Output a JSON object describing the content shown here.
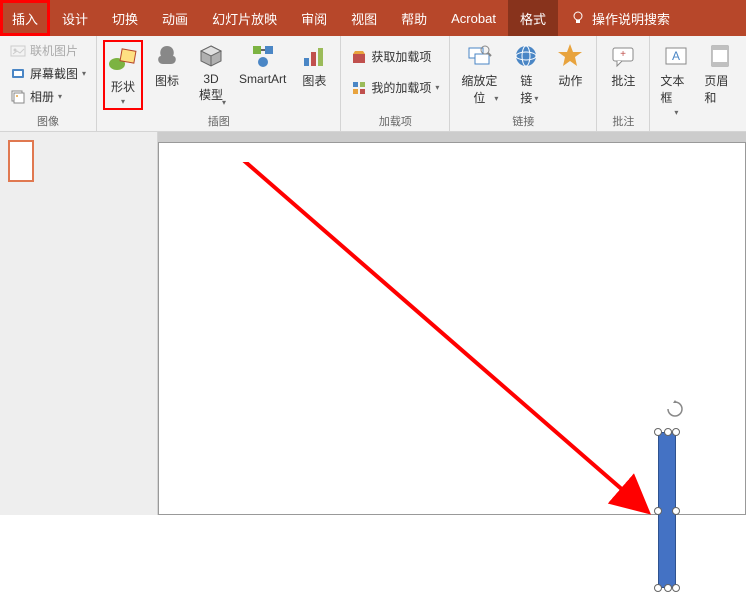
{
  "tabs": {
    "insert": "插入",
    "design": "设计",
    "transition": "切换",
    "animation": "动画",
    "slideshow": "幻灯片放映",
    "review": "审阅",
    "view": "视图",
    "help": "帮助",
    "acrobat": "Acrobat",
    "format": "格式",
    "search": "操作说明搜索"
  },
  "ribbon": {
    "images": {
      "online_pic": "联机图片",
      "screenshot": "屏幕截图",
      "album": "相册",
      "group": "图像"
    },
    "illustrations": {
      "shapes": "形状",
      "icons": "图标",
      "model3d_1": "3D",
      "model3d_2": "模型",
      "smartart": "SmartArt",
      "chart": "图表",
      "group": "插图"
    },
    "addins": {
      "get": "获取加载项",
      "my": "我的加载项",
      "group": "加载项"
    },
    "links": {
      "zoom_1": "缩放定",
      "zoom_2": "位",
      "link_1": "链",
      "link_2": "接",
      "action": "动作",
      "group": "链接"
    },
    "comments": {
      "comment": "批注",
      "group": "批注"
    },
    "text": {
      "textbox": "文本框",
      "header": "页眉和"
    }
  }
}
